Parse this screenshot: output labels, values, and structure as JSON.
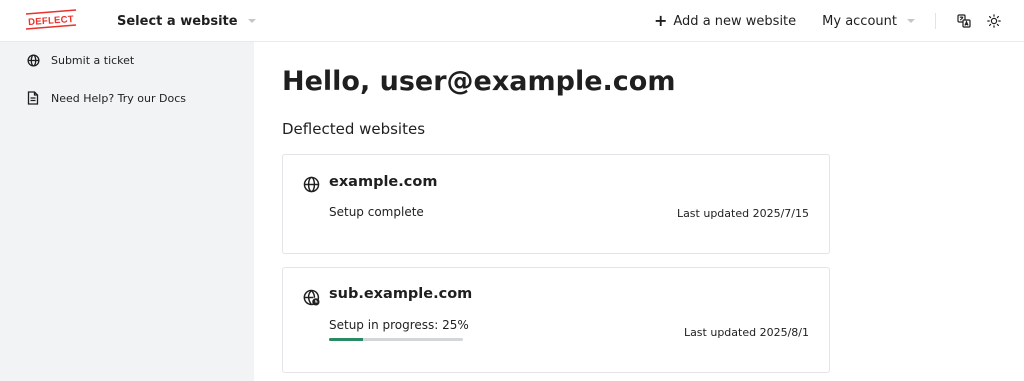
{
  "header": {
    "logo_text": "DEFLECT",
    "site_select_label": "Select a website",
    "add_website_label": "Add a new website",
    "account_label": "My account",
    "icons": {
      "plus": "plus-icon",
      "caret": "chevron-down-icon",
      "translate": "translate-icon",
      "theme": "sun-icon"
    }
  },
  "sidebar": {
    "items": [
      {
        "label": "Submit a ticket",
        "icon": "globe-icon"
      },
      {
        "label": "Need Help? Try our Docs",
        "icon": "document-icon"
      }
    ]
  },
  "main": {
    "greeting": "Hello, user@example.com",
    "section_title": "Deflected websites",
    "websites": [
      {
        "domain": "example.com",
        "status": "Setup complete",
        "updated": "Last updated 2025/7/15",
        "icon": "globe-icon"
      },
      {
        "domain": "sub.example.com",
        "status": "Setup in progress: 25%",
        "updated": "Last updated 2025/8/1",
        "icon": "globe-clock-icon",
        "progress_percent": 25
      }
    ]
  },
  "colors": {
    "brand": "#e8322d",
    "progress": "#2a8a64",
    "sidebar_bg": "#f2f3f5",
    "border": "#e3e4e7"
  }
}
